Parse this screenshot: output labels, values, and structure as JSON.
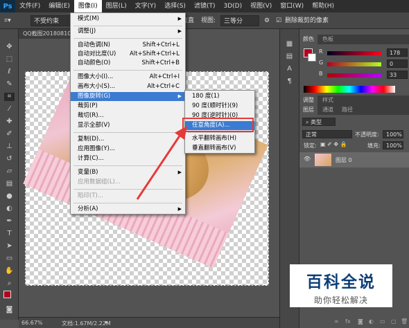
{
  "menubar": {
    "logo": "Ps",
    "items": [
      "文件(F)",
      "编辑(E)",
      "图像(I)",
      "图层(L)",
      "文字(Y)",
      "选择(S)",
      "滤镜(T)",
      "3D(D)",
      "视图(V)",
      "窗口(W)",
      "帮助(H)"
    ],
    "active_index": 2
  },
  "options": {
    "ratio_value": "不受约束",
    "straighten": "拉直",
    "view_label": "视图:",
    "view_value": "三等分",
    "delete_cropped": "删除裁剪的像素"
  },
  "document": {
    "tab": "QQ截图20180810",
    "zoom": "66.67%",
    "doc_info": "文档:1.67M/2.22M"
  },
  "image_menu": {
    "items": [
      "模式(M)",
      "调整(J)",
      "自动色调(N)",
      "自动对比度(U)",
      "自动颜色(O)",
      "图像大小(I)...",
      "画布大小(S)...",
      "图像旋转(G)",
      "裁剪(P)",
      "裁切(R)...",
      "显示全部(V)",
      "复制(D)...",
      "应用图像(Y)...",
      "计算(C)...",
      "变量(B)",
      "应用数据组(L)...",
      "陷印(T)...",
      "分析(A)"
    ],
    "shortcuts": {
      "auto_tone": "Shift+Ctrl+L",
      "auto_contrast": "Alt+Shift+Ctrl+L",
      "auto_color": "Shift+Ctrl+B",
      "image_size": "Alt+Ctrl+I",
      "canvas_size": "Alt+Ctrl+C"
    }
  },
  "rotate_menu": {
    "items": [
      "180 度(1)",
      "90 度(顺时针)(9)",
      "90 度(逆时针)(0)",
      "任意角度(A)...",
      "水平翻转画布(H)",
      "垂直翻转画布(V)"
    ],
    "highlighted_index": 3
  },
  "color_panel": {
    "tabs": [
      "颜色",
      "色板"
    ],
    "r_label": "R",
    "r_value": "178",
    "g_label": "G",
    "g_value": "0",
    "b_label": "B",
    "b_value": "33",
    "fg_color": "#b20021"
  },
  "adjust_panel": {
    "tabs": [
      "调整",
      "样式"
    ]
  },
  "layers_panel": {
    "tabs": [
      "图层",
      "通道",
      "路径"
    ],
    "kind": "类型",
    "blend_mode": "正常",
    "opacity_label": "不透明度:",
    "opacity": "100%",
    "lock_label": "锁定:",
    "fill_label": "填充:",
    "fill": "100%",
    "layer_name": "图层 0"
  },
  "watermark": {
    "title": "百科全说",
    "subtitle": "助你轻松解决"
  },
  "colors": {
    "highlight": "#3b7bd1",
    "annotation": "#e53a3a"
  }
}
